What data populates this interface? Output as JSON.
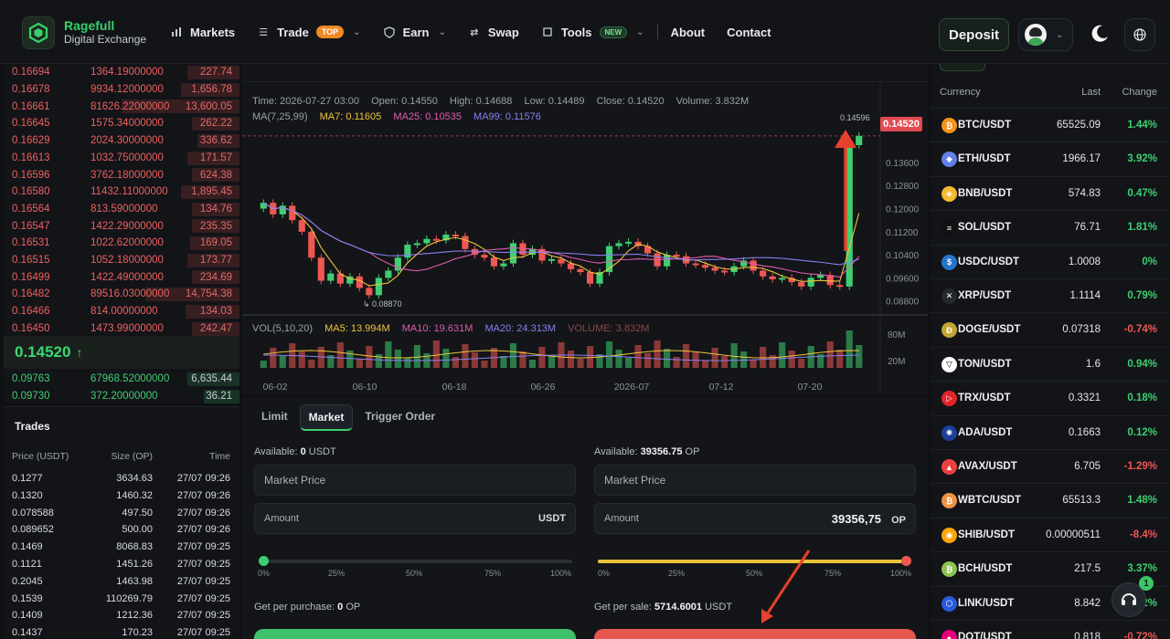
{
  "header": {
    "brand_name": "Ragefull",
    "brand_sub": "Digital Exchange",
    "nav": [
      {
        "label": "Markets"
      },
      {
        "label": "Trade",
        "badge": "TOP"
      },
      {
        "label": "Earn"
      },
      {
        "label": "Swap"
      },
      {
        "label": "Tools",
        "badge": "NEW"
      },
      {
        "label": "About"
      },
      {
        "label": "Contact"
      }
    ],
    "deposit_label": "Deposit"
  },
  "orderbook": {
    "asks": [
      {
        "price": "0.16694",
        "size": "1364.19000000",
        "total": "227.74",
        "depth": 0.22
      },
      {
        "price": "0.16678",
        "size": "9934.12000000",
        "total": "1,656.78",
        "depth": 0.25
      },
      {
        "price": "0.16661",
        "size": "81626.22000000",
        "total": "13,600.05",
        "depth": 0.5
      },
      {
        "price": "0.16645",
        "size": "1575.34000000",
        "total": "262.22",
        "depth": 0.2
      },
      {
        "price": "0.16629",
        "size": "2024.30000000",
        "total": "336.62",
        "depth": 0.18
      },
      {
        "price": "0.16613",
        "size": "1032.75000000",
        "total": "171.57",
        "depth": 0.22
      },
      {
        "price": "0.16596",
        "size": "3762.18000000",
        "total": "624.38",
        "depth": 0.2
      },
      {
        "price": "0.16580",
        "size": "11432.11000000",
        "total": "1,895.45",
        "depth": 0.25
      },
      {
        "price": "0.16564",
        "size": "813.59000000",
        "total": "134.76",
        "depth": 0.2
      },
      {
        "price": "0.16547",
        "size": "1422.29000000",
        "total": "235.35",
        "depth": 0.2
      },
      {
        "price": "0.16531",
        "size": "1022.62000000",
        "total": "169.05",
        "depth": 0.21
      },
      {
        "price": "0.16515",
        "size": "1052.18000000",
        "total": "173.77",
        "depth": 0.22
      },
      {
        "price": "0.16499",
        "size": "1422.49000000",
        "total": "234.69",
        "depth": 0.2
      },
      {
        "price": "0.16482",
        "size": "89516.03000000",
        "total": "14,754.38",
        "depth": 0.4
      },
      {
        "price": "0.16466",
        "size": "814.00000000",
        "total": "134.03",
        "depth": 0.23
      },
      {
        "price": "0.16450",
        "size": "1473.99000000",
        "total": "242.47",
        "depth": 0.2
      }
    ],
    "last_price": "0.14520",
    "bids": [
      {
        "price": "0.09763",
        "size": "67968.52000000",
        "total": "6,635.44",
        "depth": 0.22
      },
      {
        "price": "0.09730",
        "size": "372.20000000",
        "total": "36.21",
        "depth": 0.15
      }
    ]
  },
  "trades": {
    "title": "Trades",
    "headers": [
      "Price (USDT)",
      "Size (OP)",
      "Time"
    ],
    "rows": [
      [
        "0.1277",
        "3634.63",
        "27/07 09:26"
      ],
      [
        "0.1320",
        "1460.32",
        "27/07 09:26"
      ],
      [
        "0.078588",
        "497.50",
        "27/07 09:26"
      ],
      [
        "0.089652",
        "500.00",
        "27/07 09:26"
      ],
      [
        "0.1469",
        "8068.83",
        "27/07 09:25"
      ],
      [
        "0.1121",
        "1451.26",
        "27/07 09:25"
      ],
      [
        "0.2045",
        "1463.98",
        "27/07 09:25"
      ],
      [
        "0.1539",
        "110269.79",
        "27/07 09:25"
      ],
      [
        "0.1409",
        "1212.36",
        "27/07 09:25"
      ],
      [
        "0.1437",
        "170.23",
        "27/07 09:25"
      ]
    ]
  },
  "chart": {
    "time": "Time: 2026-07-27 03:00",
    "open": "Open: 0.14550",
    "high": "High: 0.14688",
    "low": "Low: 0.14489",
    "close": "Close: 0.14520",
    "volume": "Volume: 3.832M",
    "ma_label": "MA(7,25,99)",
    "ma7": "MA7: 0.11605",
    "ma25": "MA25: 0.10535",
    "ma99": "MA99: 0.11576",
    "vol_label": "VOL(5,10,20)",
    "ma5v": "MA5: 13.994M",
    "ma10v": "MA10: 19.631M",
    "ma20v": "MA20: 24.313M",
    "volume2": "VOLUME: 3.832M",
    "price_tag": "0.14520",
    "high_marker": "0.14596",
    "low_marker": "0.08870",
    "y_ticks": [
      "0.13600",
      "0.12800",
      "0.12000",
      "0.11200",
      "0.10400",
      "0.09600",
      "0.08800"
    ],
    "vol_ticks": [
      "80M",
      "20M"
    ],
    "x_ticks": [
      "06-02",
      "06-10",
      "06-18",
      "06-26",
      "2026-07",
      "07-12",
      "07-20"
    ],
    "colors": {
      "up": "#3fcf72",
      "down": "#ef5753",
      "ma7": "#f0c43c",
      "ma25": "#e05ab0",
      "ma99": "#8b7ff0"
    }
  },
  "chart_data": {
    "type": "candlestick",
    "candles": [
      {
        "o": 0.12,
        "c": 0.122
      },
      {
        "o": 0.122,
        "c": 0.118
      },
      {
        "o": 0.118,
        "c": 0.121
      },
      {
        "o": 0.121,
        "c": 0.116
      },
      {
        "o": 0.116,
        "c": 0.112
      },
      {
        "o": 0.112,
        "c": 0.103
      },
      {
        "o": 0.103,
        "c": 0.095
      },
      {
        "o": 0.095,
        "c": 0.0975
      },
      {
        "o": 0.0975,
        "c": 0.094
      },
      {
        "o": 0.094,
        "c": 0.0965
      },
      {
        "o": 0.0965,
        "c": 0.0925
      },
      {
        "o": 0.0925,
        "c": 0.09
      },
      {
        "o": 0.09,
        "c": 0.096
      },
      {
        "o": 0.096,
        "c": 0.0985
      },
      {
        "o": 0.0985,
        "c": 0.103
      },
      {
        "o": 0.103,
        "c": 0.1075
      },
      {
        "o": 0.1075,
        "c": 0.108
      },
      {
        "o": 0.108,
        "c": 0.1095
      },
      {
        "o": 0.1095,
        "c": 0.109
      },
      {
        "o": 0.109,
        "c": 0.111
      },
      {
        "o": 0.111,
        "c": 0.1105
      },
      {
        "o": 0.1105,
        "c": 0.106
      },
      {
        "o": 0.106,
        "c": 0.104
      },
      {
        "o": 0.104,
        "c": 0.103
      },
      {
        "o": 0.103,
        "c": 0.1
      },
      {
        "o": 0.1,
        "c": 0.101
      },
      {
        "o": 0.101,
        "c": 0.108
      },
      {
        "o": 0.108,
        "c": 0.104
      },
      {
        "o": 0.104,
        "c": 0.106
      },
      {
        "o": 0.106,
        "c": 0.102
      },
      {
        "o": 0.102,
        "c": 0.1025
      },
      {
        "o": 0.1025,
        "c": 0.101
      },
      {
        "o": 0.101,
        "c": 0.099
      },
      {
        "o": 0.099,
        "c": 0.098
      },
      {
        "o": 0.098,
        "c": 0.094
      },
      {
        "o": 0.094,
        "c": 0.098
      },
      {
        "o": 0.098,
        "c": 0.107
      },
      {
        "o": 0.107,
        "c": 0.108
      },
      {
        "o": 0.108,
        "c": 0.1085
      },
      {
        "o": 0.1085,
        "c": 0.107
      },
      {
        "o": 0.107,
        "c": 0.1045
      },
      {
        "o": 0.1045,
        "c": 0.1
      },
      {
        "o": 0.1,
        "c": 0.104
      },
      {
        "o": 0.104,
        "c": 0.1035
      },
      {
        "o": 0.1035,
        "c": 0.101
      },
      {
        "o": 0.101,
        "c": 0.1005
      },
      {
        "o": 0.1005,
        "c": 0.0995
      },
      {
        "o": 0.0995,
        "c": 0.0985
      },
      {
        "o": 0.0985,
        "c": 0.098
      },
      {
        "o": 0.098,
        "c": 0.1
      },
      {
        "o": 0.1,
        "c": 0.102
      },
      {
        "o": 0.102,
        "c": 0.0985
      },
      {
        "o": 0.0985,
        "c": 0.0965
      },
      {
        "o": 0.0965,
        "c": 0.0955
      },
      {
        "o": 0.0955,
        "c": 0.096
      },
      {
        "o": 0.096,
        "c": 0.0945
      },
      {
        "o": 0.0945,
        "c": 0.093
      },
      {
        "o": 0.093,
        "c": 0.096
      },
      {
        "o": 0.096,
        "c": 0.097
      },
      {
        "o": 0.097,
        "c": 0.0935
      },
      {
        "o": 0.0935,
        "c": 0.093
      },
      {
        "o": 0.093,
        "c": 0.142
      },
      {
        "o": 0.142,
        "c": 0.1452
      }
    ],
    "ylim": [
      0.086,
      0.148
    ]
  },
  "order_form": {
    "tabs": [
      "Limit",
      "Market",
      "Trigger Order"
    ],
    "active_tab": "Market",
    "buy": {
      "available_label": "Available:",
      "available_value": "0",
      "available_unit": "USDT",
      "price_placeholder": "Market Price",
      "amount_label": "Amount",
      "amount_unit": "USDT",
      "slider": 0,
      "get_label": "Get per purchase:",
      "get_value": "0",
      "get_unit": "OP"
    },
    "sell": {
      "available_label": "Available:",
      "available_value": "39356.75",
      "available_unit": "OP",
      "price_placeholder": "Market Price",
      "amount_label": "Amount",
      "amount_value": "39356,75",
      "amount_unit": "OP",
      "slider": 1,
      "get_label": "Get per sale:",
      "get_value": "5714.6001",
      "get_unit": "USDT"
    },
    "ticks": [
      "0%",
      "25%",
      "50%",
      "75%",
      "100%"
    ]
  },
  "market_list": {
    "headers": [
      "Currency",
      "Last",
      "Change"
    ],
    "rows": [
      {
        "pair": "BTC/USDT",
        "last": "65525.09",
        "change": "1.44%",
        "dir": "up",
        "color": "#f7931a",
        "glyph": "₿"
      },
      {
        "pair": "ETH/USDT",
        "last": "1966.17",
        "change": "3.92%",
        "dir": "up",
        "color": "#627eea",
        "glyph": "◆"
      },
      {
        "pair": "BNB/USDT",
        "last": "574.83",
        "change": "0.47%",
        "dir": "up",
        "color": "#f3ba2f",
        "glyph": "◈"
      },
      {
        "pair": "SOL/USDT",
        "last": "76.71",
        "change": "1.81%",
        "dir": "up",
        "color": "#111111",
        "glyph": "≡"
      },
      {
        "pair": "USDC/USDT",
        "last": "1.0008",
        "change": "0%",
        "dir": "up",
        "color": "#2775ca",
        "glyph": "$"
      },
      {
        "pair": "XRP/USDT",
        "last": "1.1114",
        "change": "0.79%",
        "dir": "up",
        "color": "#23292f",
        "glyph": "✕"
      },
      {
        "pair": "DOGE/USDT",
        "last": "0.07318",
        "change": "-0.74%",
        "dir": "down",
        "color": "#c2a633",
        "glyph": "Ð"
      },
      {
        "pair": "TON/USDT",
        "last": "1.6",
        "change": "0.94%",
        "dir": "up",
        "color": "#ffffff",
        "glyph": "▽"
      },
      {
        "pair": "TRX/USDT",
        "last": "0.3321",
        "change": "0.18%",
        "dir": "up",
        "color": "#e3242b",
        "glyph": "▷"
      },
      {
        "pair": "ADA/USDT",
        "last": "0.1663",
        "change": "0.12%",
        "dir": "up",
        "color": "#1b3f9a",
        "glyph": "✺"
      },
      {
        "pair": "AVAX/USDT",
        "last": "6.705",
        "change": "-1.29%",
        "dir": "down",
        "color": "#e84142",
        "glyph": "▲"
      },
      {
        "pair": "WBTC/USDT",
        "last": "65513.3",
        "change": "1.48%",
        "dir": "up",
        "color": "#f09242",
        "glyph": "₿"
      },
      {
        "pair": "SHIB/USDT",
        "last": "0.00000511",
        "change": "-8.4%",
        "dir": "down",
        "color": "#ffa409",
        "glyph": "◉"
      },
      {
        "pair": "BCH/USDT",
        "last": "217.5",
        "change": "3.37%",
        "dir": "up",
        "color": "#8dc351",
        "glyph": "₿"
      },
      {
        "pair": "LINK/USDT",
        "last": "8.842",
        "change": "2%",
        "dir": "up",
        "color": "#2a5ada",
        "glyph": "⬡"
      },
      {
        "pair": "DOT/USDT",
        "last": "0.818",
        "change": "-0.72%",
        "dir": "down",
        "color": "#e6007a",
        "glyph": "●"
      }
    ]
  },
  "support_badge": "1"
}
